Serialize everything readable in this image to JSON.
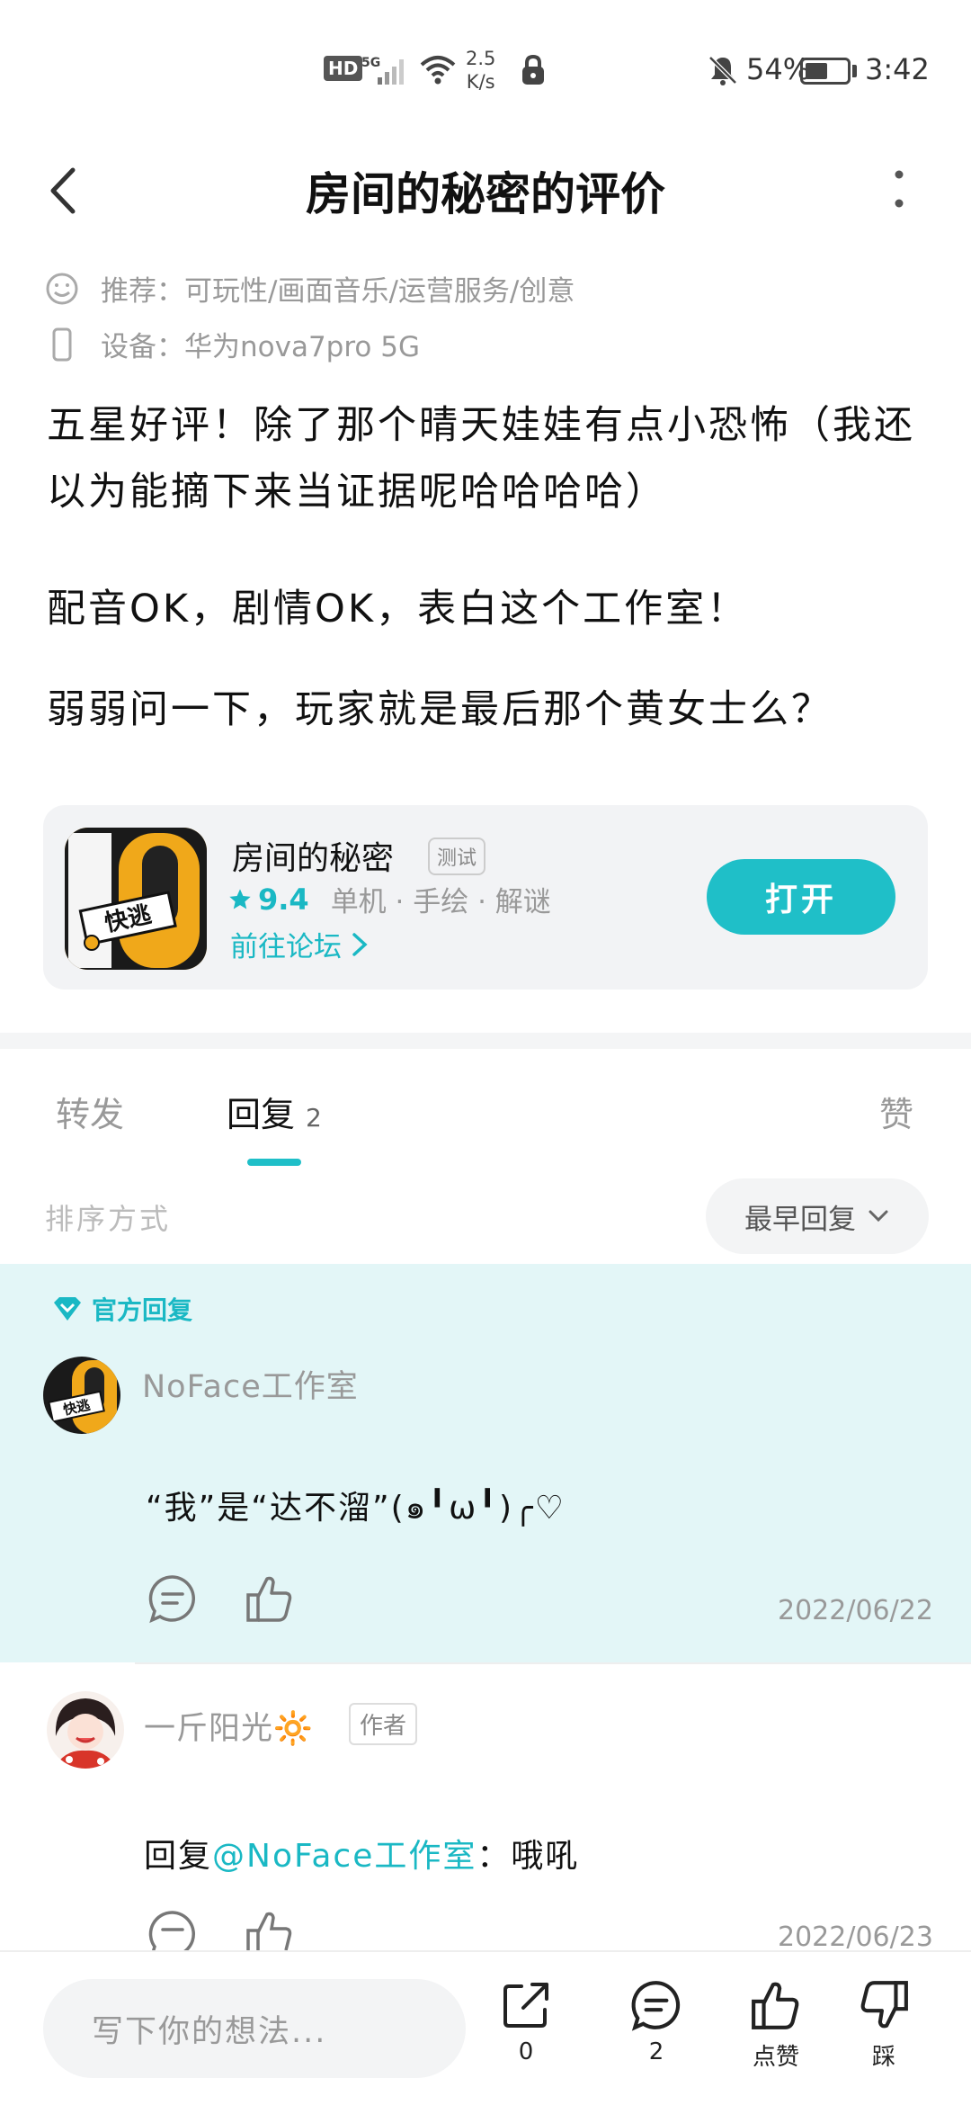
{
  "status_bar": {
    "hd": "HD",
    "signal": "5G",
    "net_speed_value": "2.5",
    "net_speed_unit": "K/s",
    "battery_pct": "54%",
    "battery_level": 0.54,
    "time": "3:42"
  },
  "header": {
    "title": "房间的秘密的评价"
  },
  "meta": {
    "recommend": "推荐：可玩性/画面音乐/运营服务/创意",
    "device": "设备：华为nova7pro 5G"
  },
  "review": {
    "paragraphs": [
      "五星好评！除了那个晴天娃娃有点小恐怖（我还以为能摘下来当证据呢哈哈哈哈）",
      "配音OK，剧情OK，表白这个工作室！",
      "弱弱问一下，玩家就是最后那个黄女士么？"
    ]
  },
  "game_card": {
    "name": "房间的秘密",
    "badge": "测试",
    "icon_text": "快逃",
    "rating": "9.4",
    "tags": "单机 · 手绘 · 解谜",
    "forum_link": "前往论坛",
    "open_button": "打开"
  },
  "tabs": {
    "forward": "转发",
    "reply": "回复",
    "reply_count": "2",
    "like": "赞"
  },
  "sort": {
    "label": "排序方式",
    "selected": "最早回复"
  },
  "comments": [
    {
      "tag": "官方回复",
      "username": "NoFace工作室",
      "avatar_text": "快逃",
      "text": "“我”是“达不溜”(๑╹ω╹)╭♡",
      "date": "2022/06/22"
    },
    {
      "username": "一斤阳光🔆",
      "badge": "作者",
      "reply_prefix": "回复",
      "mention": "@NoFace工作室",
      "text": "：哦吼",
      "date": "2022/06/23"
    }
  ],
  "bottom_bar": {
    "input_placeholder": "写下你的想法...",
    "share_count": "0",
    "comment_count": "2",
    "like_label": "点赞",
    "dislike_label": "踩"
  },
  "colors": {
    "accent": "#1fbfc8",
    "official_bg": "#e3f6f7"
  }
}
